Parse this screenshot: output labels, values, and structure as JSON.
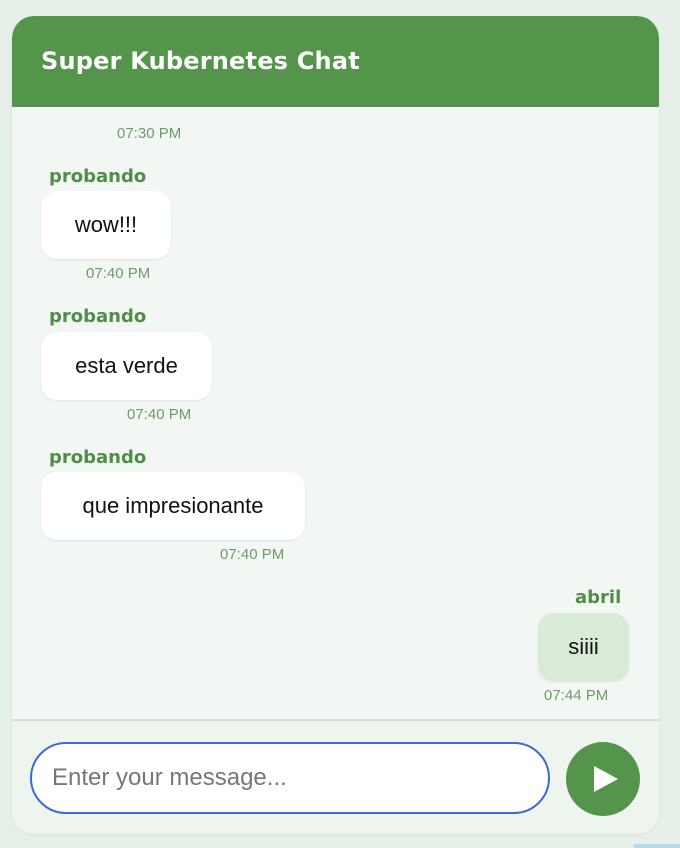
{
  "colors": {
    "header": "#55944b",
    "sender": "#4f8d48",
    "timestamp": "#6f9a6c",
    "my_bubble": "#d9ead6",
    "input_border": "#3d68d8",
    "send_button": "#55944b"
  },
  "header": {
    "title": "Super Kubernetes Chat"
  },
  "messages": [
    {
      "sender": "",
      "text": "",
      "time": "07:30 PM"
    },
    {
      "sender": "probando",
      "text": "wow!!!",
      "time": "07:40 PM"
    },
    {
      "sender": "probando",
      "text": "esta verde",
      "time": "07:40 PM"
    },
    {
      "sender": "probando",
      "text": "que impresionante",
      "time": "07:40 PM"
    },
    {
      "sender": "abril",
      "text": "siiii",
      "time": "07:44 PM"
    }
  ],
  "composer": {
    "placeholder": "Enter your message...",
    "value": "",
    "send_icon": "send-icon"
  }
}
